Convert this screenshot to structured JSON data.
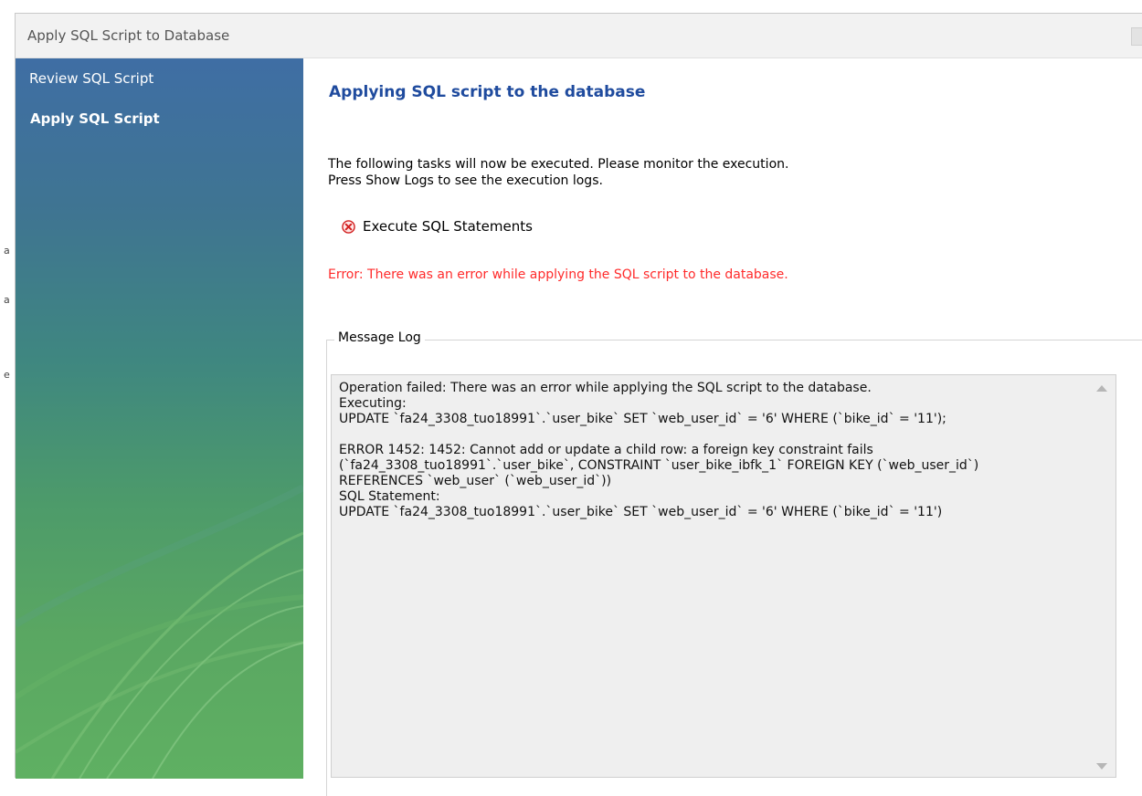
{
  "window": {
    "title": "Apply SQL Script to Database"
  },
  "sidebar": {
    "steps": [
      {
        "label": "Review SQL Script",
        "active": false
      },
      {
        "label": "Apply SQL Script",
        "active": true
      }
    ]
  },
  "main": {
    "heading": "Applying SQL script to the database",
    "intro_line1": "The following tasks will now be executed. Please monitor the execution.",
    "intro_line2": "Press Show Logs to see the execution logs.",
    "task": {
      "label": "Execute SQL Statements",
      "status_icon": "error-circle-icon"
    },
    "error_message": "Error: There was an error while applying the SQL script to the database.",
    "message_log": {
      "title": "Message Log",
      "text": "Operation failed: There was an error while applying the SQL script to the database.\nExecuting:\nUPDATE `fa24_3308_tuo18991`.`user_bike` SET `web_user_id` = '6' WHERE (`bike_id` = '11');\n\nERROR 1452: 1452: Cannot add or update a child row: a foreign key constraint fails\n(`fa24_3308_tuo18991`.`user_bike`, CONSTRAINT `user_bike_ibfk_1` FOREIGN KEY (`web_user_id`)\nREFERENCES `web_user` (`web_user_id`))\nSQL Statement:\nUPDATE `fa24_3308_tuo18991`.`user_bike` SET `web_user_id` = '6' WHERE (`bike_id` = '11')"
    }
  },
  "colors": {
    "heading": "#1f4b9e",
    "error": "#ff2b2b",
    "sidebar_top": "#3f6ea4",
    "sidebar_bottom": "#5fb062"
  }
}
